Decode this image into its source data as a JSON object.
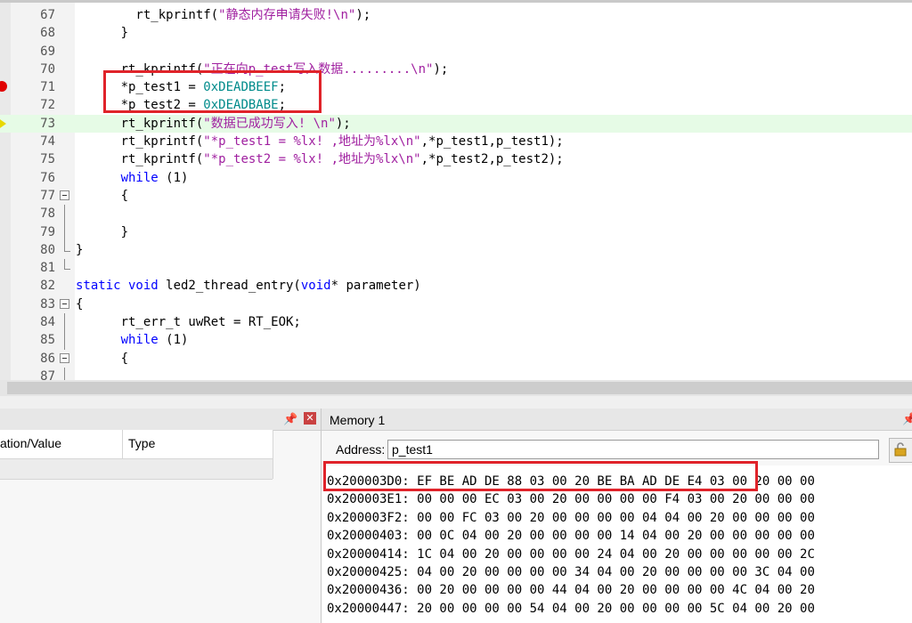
{
  "editor": {
    "lines": [
      {
        "num": "67",
        "tokens": [
          {
            "t": "        rt_kprintf(",
            "c": ""
          },
          {
            "t": "\"静态内存申请失败!\\n\"",
            "c": "str"
          },
          {
            "t": ");",
            "c": ""
          }
        ]
      },
      {
        "num": "68",
        "tokens": [
          {
            "t": "      }",
            "c": ""
          }
        ]
      },
      {
        "num": "69",
        "tokens": []
      },
      {
        "num": "70",
        "tokens": [
          {
            "t": "      rt_kprintf(",
            "c": ""
          },
          {
            "t": "\"正在向p_test写入数据.........\\n\"",
            "c": "str"
          },
          {
            "t": ");",
            "c": ""
          }
        ]
      },
      {
        "num": "71",
        "tokens": [
          {
            "t": "      *p_test1 = ",
            "c": ""
          },
          {
            "t": "0xDEADBEEF",
            "c": "hex"
          },
          {
            "t": ";",
            "c": ""
          }
        ]
      },
      {
        "num": "72",
        "tokens": [
          {
            "t": "      *p_test2 = ",
            "c": ""
          },
          {
            "t": "0xDEADBABE",
            "c": "hex"
          },
          {
            "t": ";",
            "c": ""
          }
        ]
      },
      {
        "num": "73",
        "tokens": [
          {
            "t": "      rt_kprintf(",
            "c": ""
          },
          {
            "t": "\"数据已成功写入! \\n\"",
            "c": "str"
          },
          {
            "t": ");",
            "c": ""
          }
        ]
      },
      {
        "num": "74",
        "tokens": [
          {
            "t": "      rt_kprintf(",
            "c": ""
          },
          {
            "t": "\"*p_test1 = %lx! ,地址为%lx\\n\"",
            "c": "str"
          },
          {
            "t": ",*p_test1,p_test1);",
            "c": ""
          }
        ]
      },
      {
        "num": "75",
        "tokens": [
          {
            "t": "      rt_kprintf(",
            "c": ""
          },
          {
            "t": "\"*p_test2 = %lx! ,地址为%lx\\n\"",
            "c": "str"
          },
          {
            "t": ",*p_test2,p_test2);",
            "c": ""
          }
        ]
      },
      {
        "num": "76",
        "tokens": [
          {
            "t": "      ",
            "c": ""
          },
          {
            "t": "while",
            "c": "kw"
          },
          {
            "t": " (1)",
            "c": ""
          }
        ]
      },
      {
        "num": "77",
        "tokens": [
          {
            "t": "      {",
            "c": ""
          }
        ]
      },
      {
        "num": "78",
        "tokens": []
      },
      {
        "num": "79",
        "tokens": [
          {
            "t": "      }",
            "c": ""
          }
        ]
      },
      {
        "num": "80",
        "tokens": [
          {
            "t": "}",
            "c": ""
          }
        ]
      },
      {
        "num": "81",
        "tokens": []
      },
      {
        "num": "82",
        "tokens": [
          {
            "t": "static void",
            "c": "kw"
          },
          {
            "t": " led2_thread_entry(",
            "c": ""
          },
          {
            "t": "void",
            "c": "kw"
          },
          {
            "t": "* parameter)",
            "c": ""
          }
        ]
      },
      {
        "num": "83",
        "tokens": [
          {
            "t": "{",
            "c": ""
          }
        ]
      },
      {
        "num": "84",
        "tokens": [
          {
            "t": "      rt_err_t uwRet = RT_EOK;",
            "c": ""
          }
        ]
      },
      {
        "num": "85",
        "tokens": [
          {
            "t": "      ",
            "c": ""
          },
          {
            "t": "while",
            "c": "kw"
          },
          {
            "t": " (1)",
            "c": ""
          }
        ]
      },
      {
        "num": "86",
        "tokens": [
          {
            "t": "      {",
            "c": ""
          }
        ]
      },
      {
        "num": "87",
        "tokens": []
      }
    ]
  },
  "watch": {
    "col_location": "ation/Value",
    "col_type": "Type",
    "pin_icon": "pin-icon",
    "close_icon": "close-icon"
  },
  "memory": {
    "title": "Memory 1",
    "address_label": "Address:",
    "address_value": "p_test1",
    "rows": [
      "0x200003D0: EF BE AD DE 88 03 00 20 BE BA AD DE E4 03 00 20 00 00",
      "0x200003E1: 00 00 00 EC 03 00 20 00 00 00 00 F4 03 00 20 00 00 00",
      "0x200003F2: 00 00 FC 03 00 20 00 00 00 00 04 04 00 20 00 00 00 00",
      "0x20000403: 00 0C 04 00 20 00 00 00 00 14 04 00 20 00 00 00 00 00",
      "0x20000414: 1C 04 00 20 00 00 00 00 24 04 00 20 00 00 00 00 00 2C",
      "0x20000425: 04 00 20 00 00 00 00 34 04 00 20 00 00 00 00 3C 04 00",
      "0x20000436: 00 20 00 00 00 00 44 04 00 20 00 00 00 00 4C 04 00 20",
      "0x20000447: 20 00 00 00 00 54 04 00 20 00 00 00 00 5C 04 00 20 00"
    ]
  },
  "colors": {
    "highlight_box": "#e0232a",
    "current_line": "#e6fbe6",
    "keyword": "#0000ff",
    "string": "#a020a0",
    "hex_literal": "#008b8b"
  }
}
